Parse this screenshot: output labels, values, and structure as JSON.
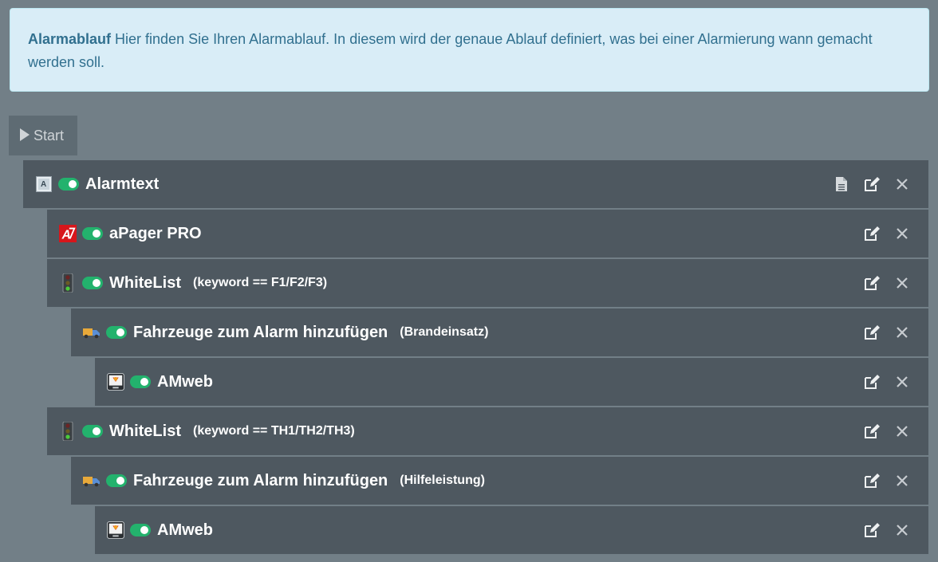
{
  "info": {
    "heading": "Alarmablauf",
    "text": " Hier finden Sie Ihren Alarmablauf. In diesem wird der genaue Ablauf definiert, was bei einer Alarmierung wann gemacht werden soll."
  },
  "start_label": "Start",
  "rows": [
    {
      "icon": "alarmtext-icon",
      "title": "Alarmtext",
      "condition": "",
      "enabled": true,
      "has_document": true
    },
    {
      "icon": "apager-icon",
      "title": "aPager PRO",
      "condition": "",
      "enabled": true
    },
    {
      "icon": "traffic-light-icon",
      "title": "WhiteList",
      "condition": "(keyword == F1/F2/F3)",
      "enabled": true
    },
    {
      "icon": "truck-icon",
      "title": "Fahrzeuge zum Alarm hinzufügen",
      "condition": "(Brandeinsatz)",
      "enabled": true
    },
    {
      "icon": "amweb-icon",
      "title": "AMweb",
      "condition": "",
      "enabled": true
    },
    {
      "icon": "traffic-light-icon",
      "title": "WhiteList",
      "condition": "(keyword == TH1/TH2/TH3)",
      "enabled": true
    },
    {
      "icon": "truck-icon",
      "title": "Fahrzeuge zum Alarm hinzufügen",
      "condition": "(Hilfeleistung)",
      "enabled": true
    },
    {
      "icon": "amweb-icon",
      "title": "AMweb",
      "condition": "",
      "enabled": true
    }
  ]
}
